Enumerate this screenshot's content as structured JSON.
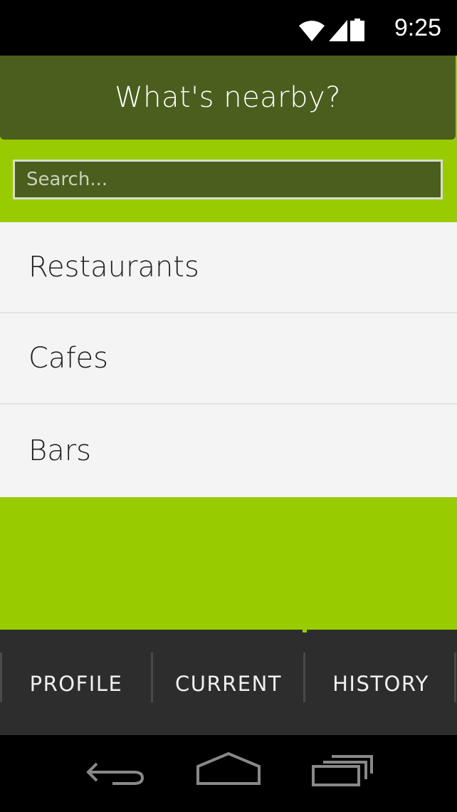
{
  "status_bar": {
    "time": "9:25",
    "icons": [
      "wifi-icon",
      "cellular-signal-icon",
      "battery-icon"
    ]
  },
  "header": {
    "title": "What's nearby?"
  },
  "search": {
    "placeholder": "Search..."
  },
  "categories": [
    {
      "label": "Restaurants"
    },
    {
      "label": "Cafes"
    },
    {
      "label": "Bars"
    }
  ],
  "tabs": [
    {
      "label": "PROFILE"
    },
    {
      "label": "CURRENT"
    },
    {
      "label": "HISTORY"
    }
  ],
  "nav_bar": {
    "icons": [
      "back-icon",
      "home-icon",
      "recent-apps-icon"
    ]
  },
  "colors": {
    "accent": "#99cc00",
    "header": "#4a5e1e",
    "tab_bar": "#2d2d2d",
    "list_bg": "#f4f4f4"
  }
}
